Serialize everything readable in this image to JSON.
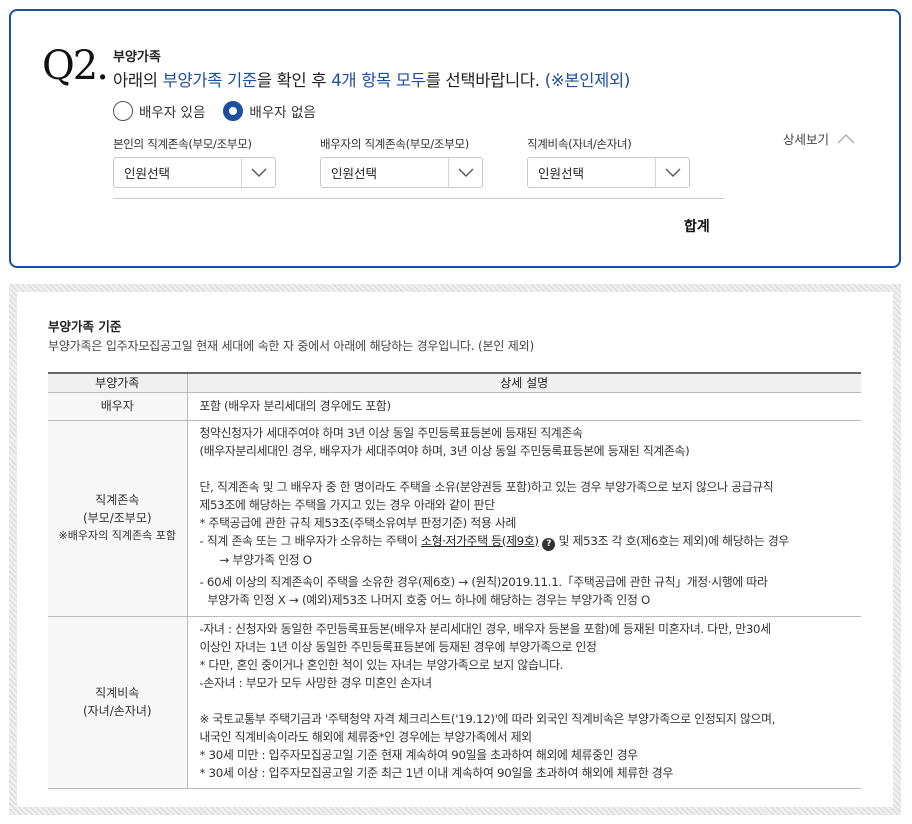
{
  "question": {
    "number": "Q2",
    "dot": ".",
    "small_title": "부양가족",
    "text_parts": {
      "p1": "아래의 ",
      "p2": "부양가족 기준",
      "p3": "을 확인 후 ",
      "p4": "4개 항목 모두",
      "p5": "를 선택바랍니다. ",
      "p6": "(※본인제외)"
    },
    "accent_color": "#1d4fa0"
  },
  "radios": [
    {
      "label": "배우자 있음",
      "checked": false
    },
    {
      "label": "배우자 없음",
      "checked": true
    }
  ],
  "selects": [
    {
      "label": "본인의 직계존속(부모/조부모)",
      "value": "인원선택"
    },
    {
      "label": "배우자의 직계존속(부모/조부모)",
      "value": "인원선택"
    },
    {
      "label": "직계비속(자녀/손자녀)",
      "value": "인원선택"
    }
  ],
  "detail_toggle": "상세보기",
  "sum_label": "합계",
  "criteria": {
    "title": "부양가족 기준",
    "desc": "부양가족은 입주자모집공고일 현재 세대에 속한 자 중에서 아래에 해당하는 경우입니다. (본인 제외)",
    "headers": [
      "부양가족",
      "상세 설명"
    ],
    "rows": {
      "spouse": {
        "name": "배우자",
        "desc": "포함 (배우자 분리세대의 경우에도 포함)"
      },
      "parents": {
        "name1": "직계존속",
        "name2": "(부모/조부모)",
        "name3": "※배우자의 직계존속 포함",
        "l1": "청약신청자가 세대주여야 하며 3년 이상 동일 주민등록표등본에 등재된 직계존속",
        "l2": "(배우자분리세대인 경우, 배우자가 세대주여야 하며, 3년 이상 동일 주민등록표등본에 등재된 직계존속)",
        "l3": "단, 직계존속 및 그 배우자 중 한 명이라도 주택을 소유(분양권등 포함)하고 있는 경우 부양가족으로 보지 않으나 공급규칙",
        "l4": "제53조에 해당하는 주택을 가지고 있는 경우 아래와 같이 판단",
        "l5": "* 주택공급에 관한 규칙 제53조(주택소유여부 판정기준) 적용 사례",
        "l6a": "- 직계 존속 또는 그 배우자가 소유하는 주택이 ",
        "l6link": "소형·저가주택 등(제9호)",
        "l6q": "?",
        "l6b": " 및 제53조 각 호(제6호는 제외)에 해당하는 경우",
        "l7": "→ 부양가족 인정 O",
        "l8": "- 60세 이상의 직계존속이 주택을 소유한 경우(제6호) → (원칙)2019.11.1.「주택공급에 관한 규칙」개정·시행에 따라",
        "l9": "부양가족 인정 X → (예외)제53조 나머지 호중 어느 하나에 해당하는 경우는 부양가족 인정 O"
      },
      "children": {
        "name1": "직계비속",
        "name2": "(자녀/손자녀)",
        "l1": "-자녀 : 신청자와 동일한 주민등록표등본(배우자 분리세대인 경우, 배우자 등본을 포함)에 등재된 미혼자녀. 다만, 만30세",
        "l2": "이상인 자녀는 1년 이상 동일한 주민등록표등본에 등재된 경우에 부양가족으로 인정",
        "l3": "* 다만, 혼인 중이거나 혼인한 적이 있는 자녀는 부양가족으로 보지 않습니다.",
        "l4": "-손자녀 : 부모가 모두 사망한 경우 미혼인 손자녀",
        "l5": "※ 국토교통부 주택기금과 '주택청약 자격 체크리스트('19.12)'에 따라 외국인 직계비속은 부양가족으로 인정되지 않으며,",
        "l6": "내국인 직계비속이라도 해외에 체류중*인 경우에는 부양가족에서 제외",
        "l7": "* 30세 미만 : 입주자모집공고일 기준 현재 계속하여 90일을 초과하여 해외에 체류중인 경우",
        "l8": "* 30세 이상 : 입주자모집공고일 기준 최근 1년 이내 계속하여 90일을 초과하여 해외에 체류한 경우"
      }
    }
  }
}
